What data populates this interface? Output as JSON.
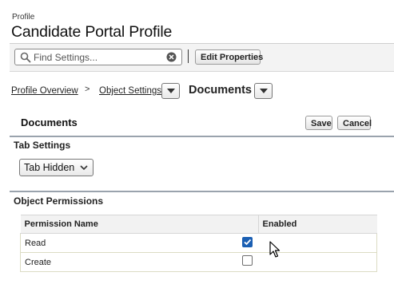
{
  "header": {
    "eyebrow": "Profile",
    "title": "Candidate Portal Profile"
  },
  "toolbar": {
    "search_placeholder": "Find Settings...",
    "edit_label": "Edit Properties"
  },
  "breadcrumb": {
    "items": [
      "Profile Overview",
      "Object Settings"
    ],
    "separator": ">",
    "current": "Documents"
  },
  "section": {
    "title": "Documents",
    "save_label": "Save",
    "cancel_label": "Cancel"
  },
  "tab_settings": {
    "heading": "Tab Settings",
    "selected": "Tab Hidden"
  },
  "object_permissions": {
    "heading": "Object Permissions",
    "columns": [
      "Permission Name",
      "Enabled"
    ],
    "rows": [
      {
        "name": "Read",
        "enabled": true
      },
      {
        "name": "Create",
        "enabled": false
      }
    ]
  },
  "colors": {
    "checkbox_checked": "#1b5fb3",
    "section_rule": "#9aa3ad"
  }
}
